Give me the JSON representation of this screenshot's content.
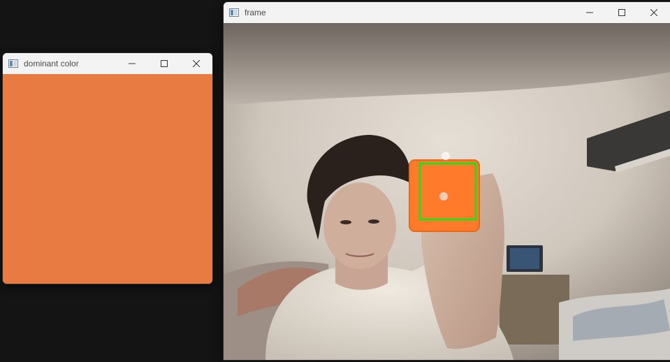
{
  "windows": {
    "dominant": {
      "title": "dominant color",
      "swatch_color": "#e87b42"
    },
    "frame": {
      "title": "frame",
      "detection_box_color": "#22e01a"
    }
  },
  "icons": {
    "app": "opencv-window-icon",
    "minimize": "minimize-icon",
    "maximize": "maximize-icon",
    "close": "close-icon"
  }
}
